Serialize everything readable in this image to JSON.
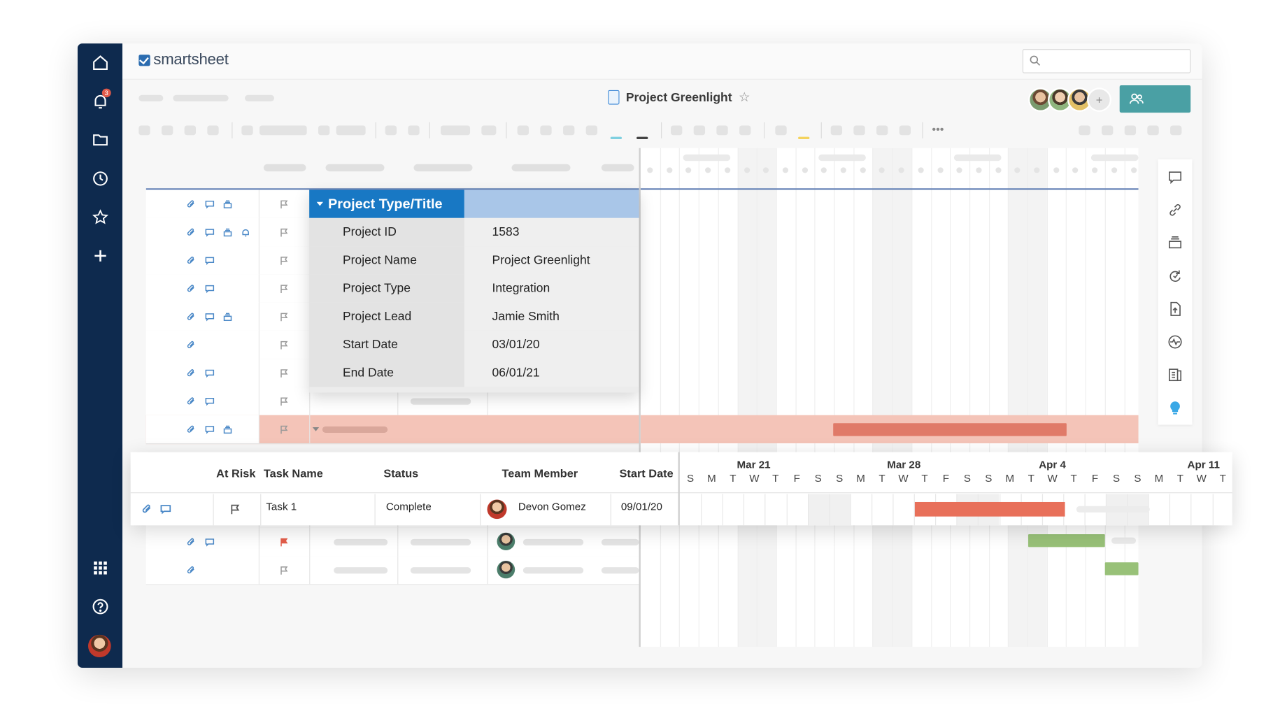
{
  "app": {
    "logo_text": "smartsheet",
    "notification_count": "3"
  },
  "sheet": {
    "title": "Project Greenlight"
  },
  "search": {
    "placeholder": ""
  },
  "colors": {
    "rail": "#0e2a4e",
    "accent_blue": "#1878c4",
    "at_risk_bar": "#e8705a",
    "green_bar": "#7fae5b",
    "share_button": "#4aa0a4"
  },
  "icons": {
    "rail": [
      "home-icon",
      "bell-icon",
      "folder-icon",
      "clock-icon",
      "star-icon",
      "plus-icon",
      "apps-grid-icon",
      "help-icon"
    ],
    "right_panel": [
      "comment-icon",
      "link-icon",
      "proofs-icon",
      "update-requests-icon",
      "publish-icon",
      "activity-log-icon",
      "summary-icon",
      "lightbulb-icon"
    ]
  },
  "summary_panel": {
    "heading": "Project Type/Title",
    "fields": [
      {
        "label": "Project ID",
        "value": "1583"
      },
      {
        "label": "Project Name",
        "value": "Project Greenlight"
      },
      {
        "label": "Project Type",
        "value": "Integration"
      },
      {
        "label": "Project Lead",
        "value": "Jamie Smith"
      },
      {
        "label": "Start Date",
        "value": "03/01/20"
      },
      {
        "label": "End Date",
        "value": "06/01/21"
      }
    ]
  },
  "focus_row": {
    "columns": {
      "at_risk": "At Risk",
      "task_name": "Task Name",
      "status": "Status",
      "team_member": "Team Member",
      "start_date": "Start Date"
    },
    "task": {
      "name": "Task 1",
      "status": "Complete",
      "member": "Devon Gomez",
      "start": "09/01/20"
    },
    "timeline": {
      "weeks": [
        "Mar 21",
        "Mar 28",
        "Apr 4",
        "Apr 11"
      ],
      "days": [
        "S",
        "M",
        "T",
        "W",
        "T",
        "F",
        "S",
        "S",
        "M",
        "T",
        "W",
        "T",
        "F",
        "S",
        "S",
        "M",
        "T",
        "W",
        "T",
        "F",
        "S",
        "S",
        "M",
        "T",
        "W",
        "T"
      ]
    }
  }
}
